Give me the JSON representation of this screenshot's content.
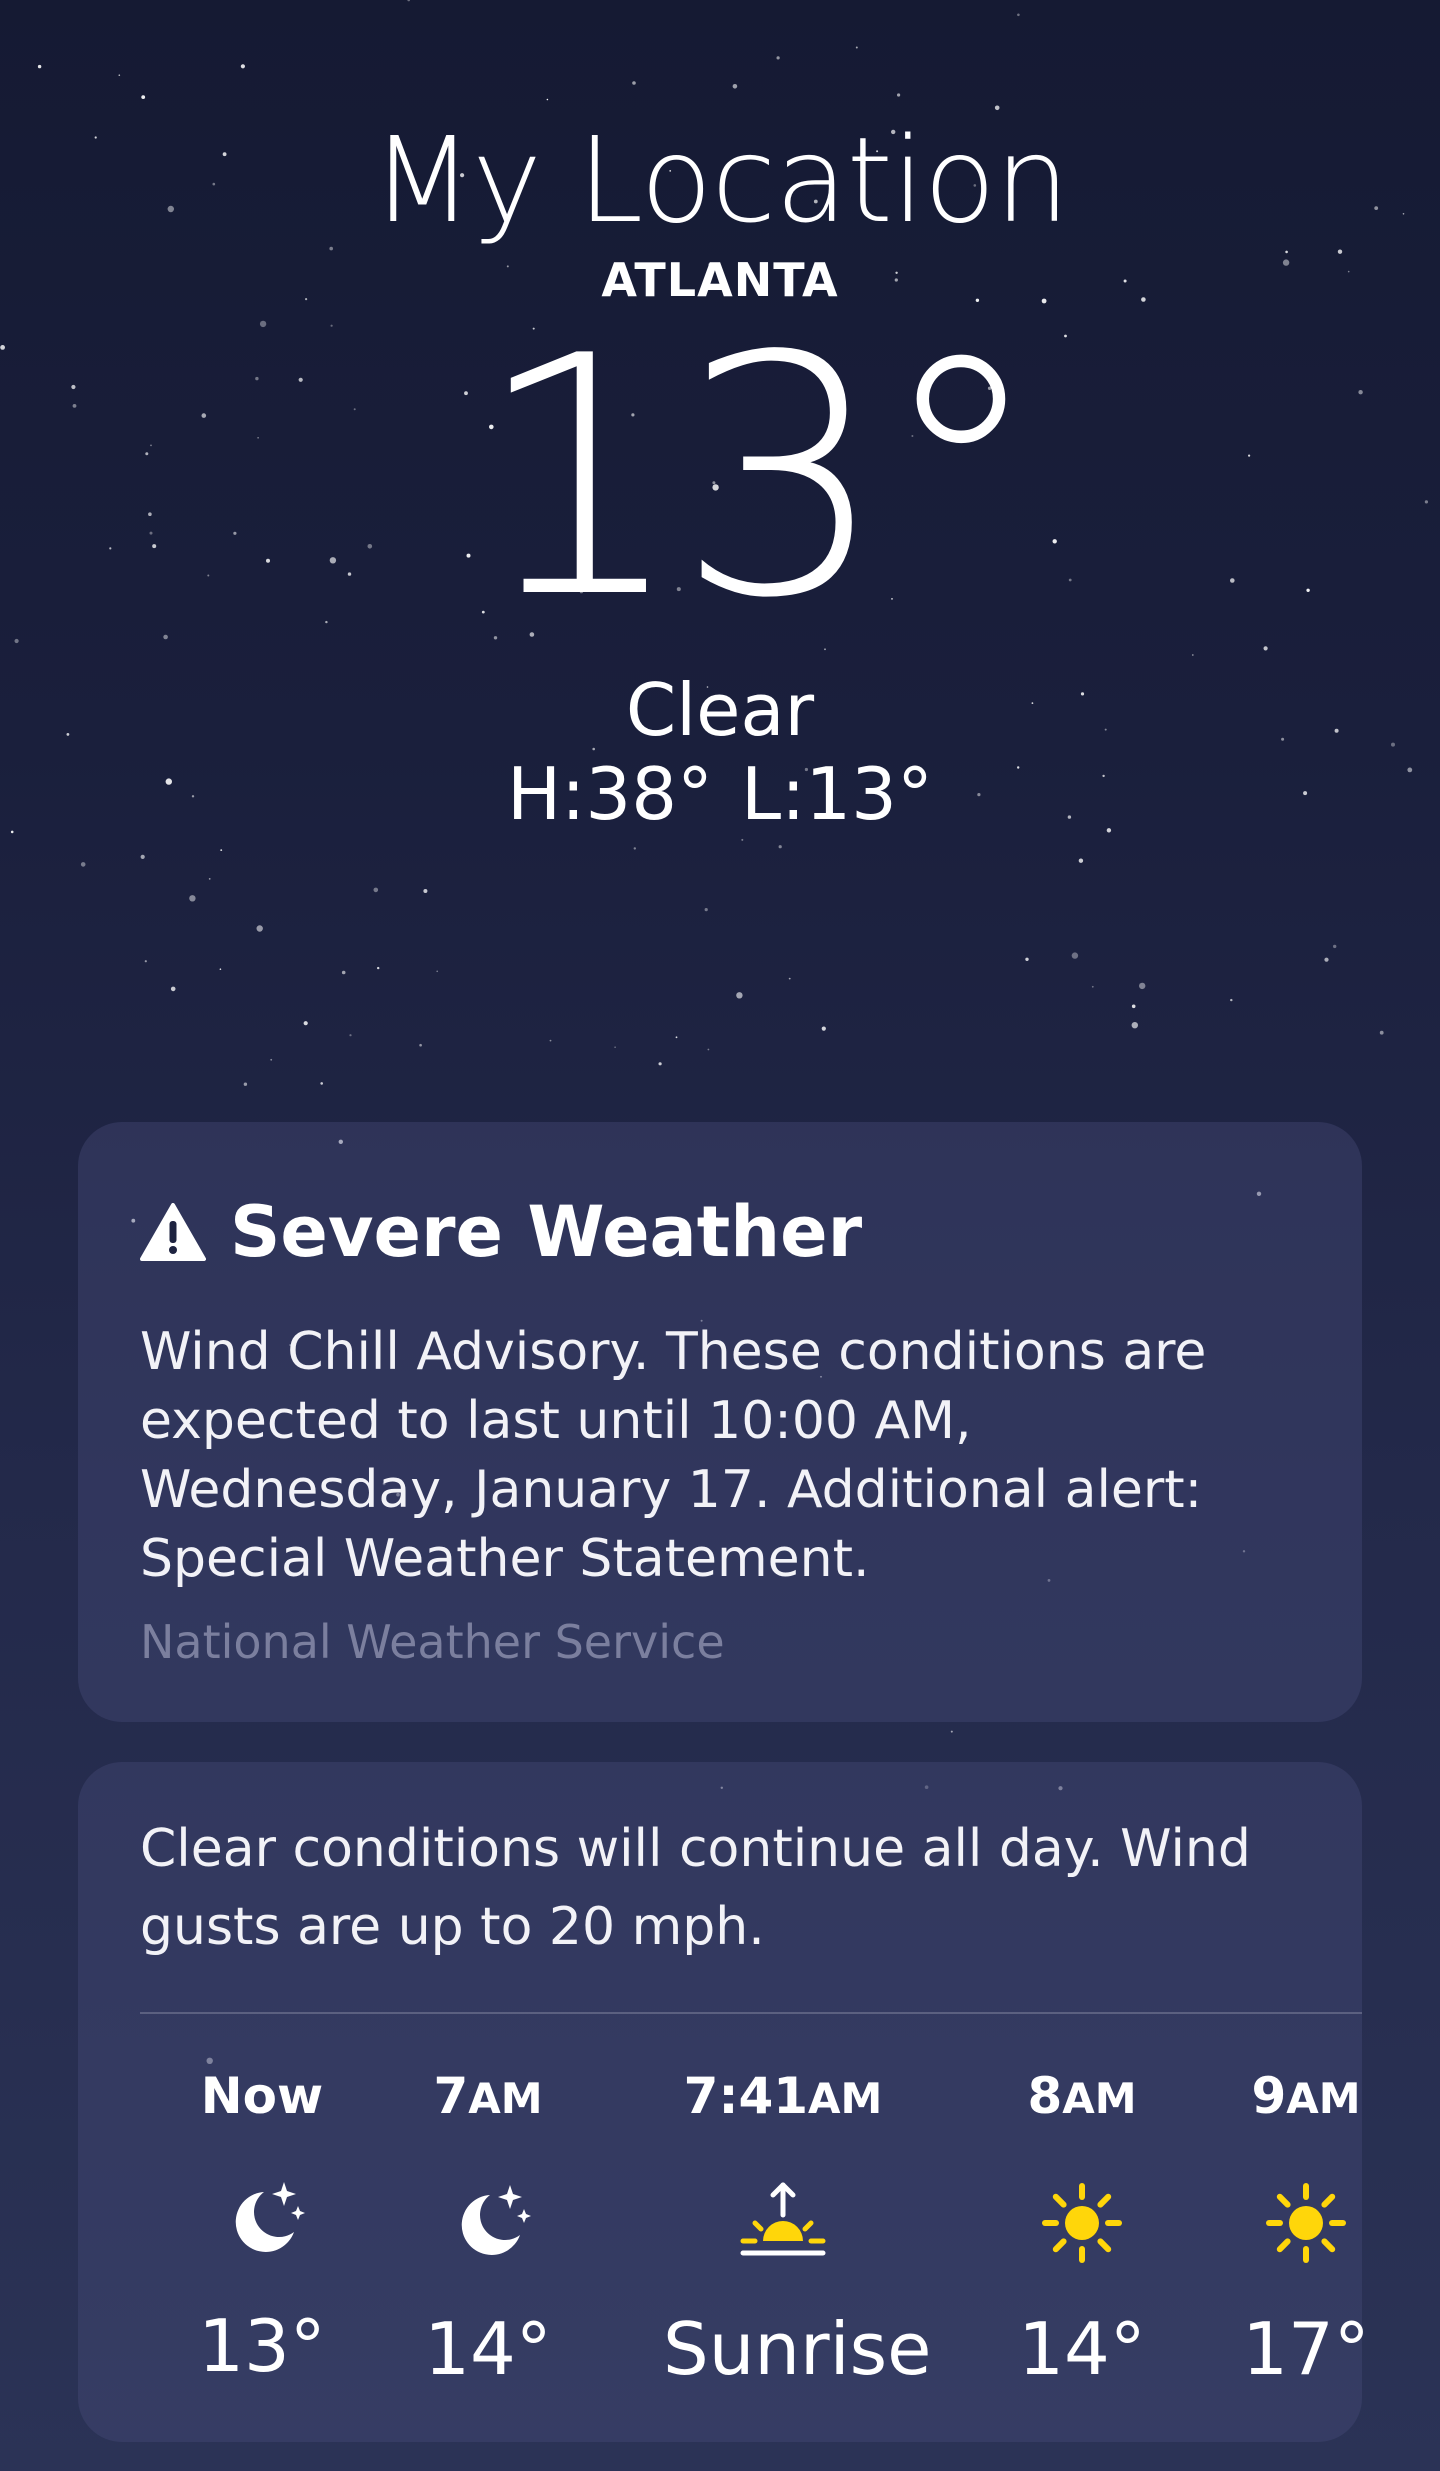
{
  "location": {
    "title": "My Location",
    "city": "ATLANTA",
    "temperature": "13°",
    "condition": "Clear",
    "high": "H:38°",
    "low": "L:13°"
  },
  "alert": {
    "title": "Severe Weather",
    "icon": "warning-triangle-icon",
    "body": "Wind Chill Advisory. These conditions are expected to last until 10:00 AM, Wednesday, January 17. Additional alert: Special Weather Statement.",
    "source": "National Weather Service"
  },
  "forecast": {
    "summary": "Clear conditions will continue all day. Wind gusts are up to 20 mph.",
    "hours": [
      {
        "time": "Now",
        "suffix": "",
        "icon": "moon-stars-icon",
        "value": "13°"
      },
      {
        "time": "7",
        "suffix": "AM",
        "icon": "moon-stars-icon",
        "value": "14°"
      },
      {
        "time": "7:41",
        "suffix": "AM",
        "icon": "sunrise-icon",
        "value": "Sunrise"
      },
      {
        "time": "8",
        "suffix": "AM",
        "icon": "sun-icon",
        "value": "14°"
      },
      {
        "time": "9",
        "suffix": "AM",
        "icon": "sun-icon",
        "value": "17°"
      }
    ]
  },
  "colors": {
    "sun": "#ffd60a",
    "background_top": "#151a33",
    "background_bottom": "#2b3356",
    "secondary_text": "#7b7f9e"
  }
}
